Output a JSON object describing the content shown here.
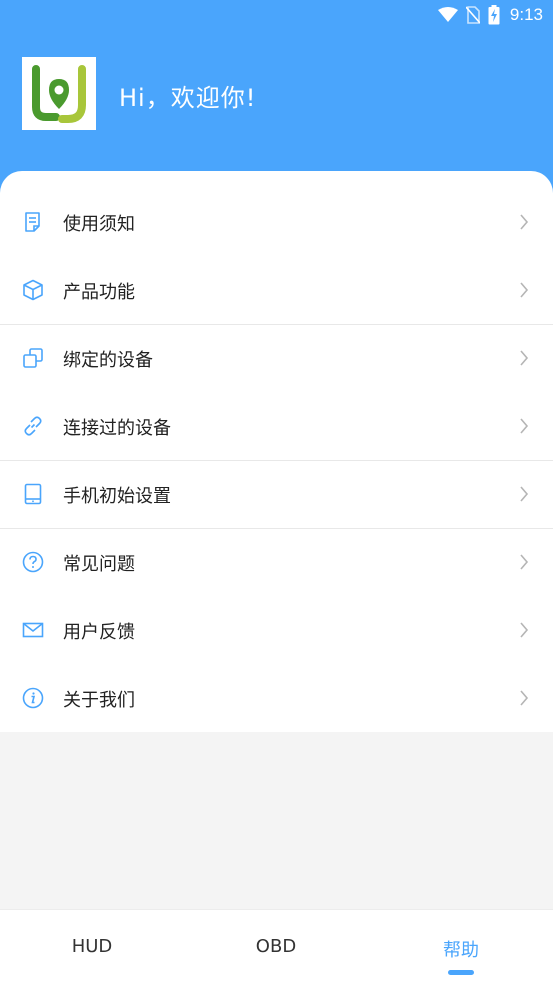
{
  "status_bar": {
    "time": "9:13",
    "icons": [
      "wifi-icon",
      "no-sim-icon",
      "battery-charging-icon"
    ]
  },
  "header": {
    "greeting": "Hi，欢迎你!",
    "avatar_icon": "app-logo-icon"
  },
  "menu": {
    "items": [
      {
        "label": "使用须知",
        "icon": "document-icon"
      },
      {
        "label": "产品功能",
        "icon": "cube-icon"
      },
      {
        "label": "绑定的设备",
        "icon": "devices-icon"
      },
      {
        "label": "连接过的设备",
        "icon": "link-icon"
      },
      {
        "label": "手机初始设置",
        "icon": "tablet-icon"
      },
      {
        "label": "常见问题",
        "icon": "question-icon"
      },
      {
        "label": "用户反馈",
        "icon": "mail-icon"
      },
      {
        "label": "关于我们",
        "icon": "info-icon"
      }
    ]
  },
  "bottom_nav": {
    "tabs": [
      {
        "label": "HUD",
        "active": false
      },
      {
        "label": "OBD",
        "active": false
      },
      {
        "label": "帮助",
        "active": true
      }
    ]
  },
  "colors": {
    "accent": "#4aa5fc",
    "header_bg": "#4aa5fc",
    "logo_green": "#4a9a2e",
    "logo_lime": "#a8c63a"
  }
}
